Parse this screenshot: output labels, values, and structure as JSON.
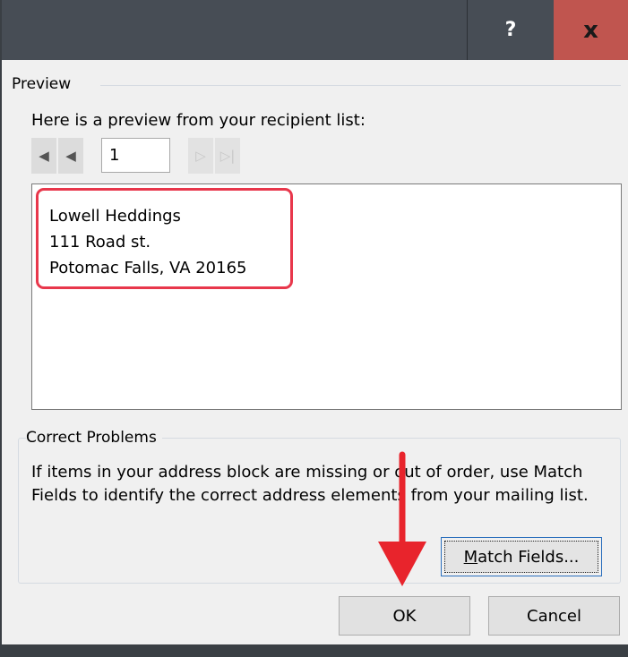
{
  "titlebar": {
    "help_label": "?",
    "close_label": "x"
  },
  "preview": {
    "group_label": "Preview",
    "intro": "Here is a preview from your recipient list:",
    "record_value": "1",
    "nav": {
      "first_icon": "first-record-icon",
      "prev_icon": "previous-record-icon",
      "next_icon": "next-record-icon",
      "last_icon": "last-record-icon"
    },
    "address_lines": [
      "Lowell Heddings",
      "111 Road st.",
      "Potomac Falls, VA 20165"
    ]
  },
  "correct_problems": {
    "group_label": "Correct Problems",
    "description": "If items in your address block are missing or out of order, use Match Fields to identify the correct address elements from your mailing list.",
    "match_fields_mnemonic": "M",
    "match_fields_rest": "atch Fields..."
  },
  "buttons": {
    "ok": "OK",
    "cancel": "Cancel"
  },
  "colors": {
    "titlebar": "#474d55",
    "close": "#c0554f",
    "highlight": "#e8374b",
    "arrow": "#e8242c"
  }
}
